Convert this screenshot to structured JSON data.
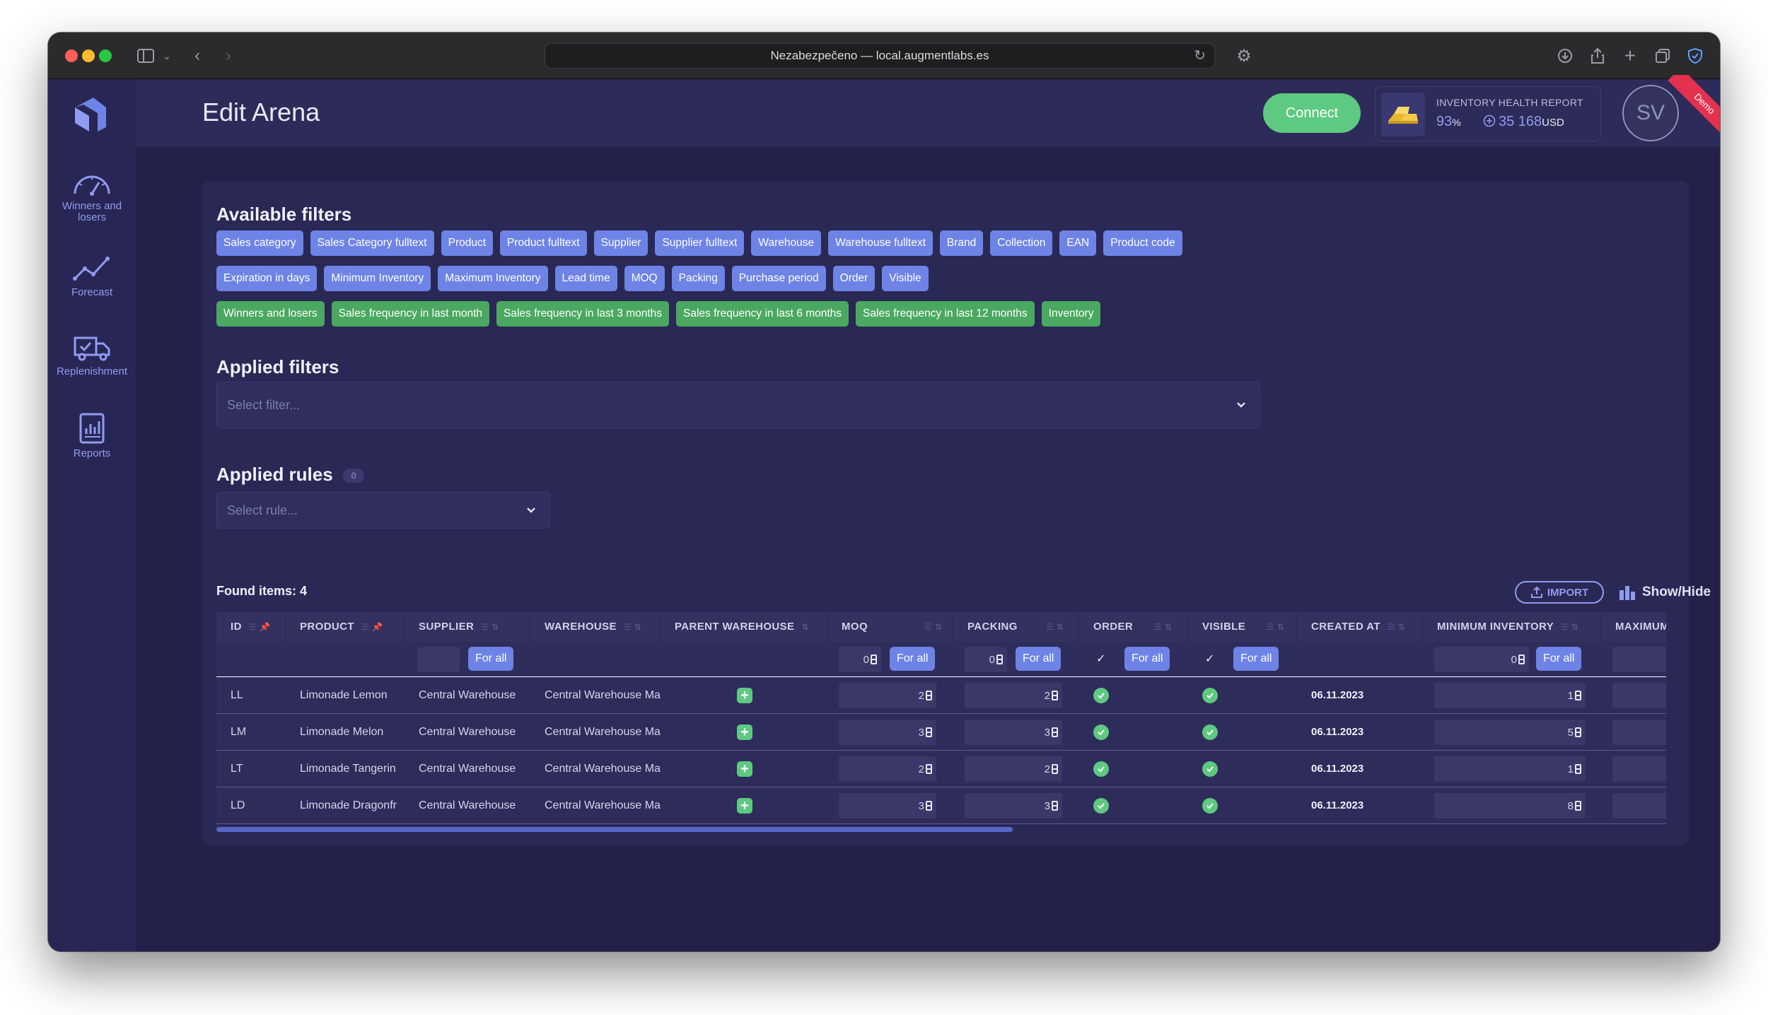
{
  "browser": {
    "url": "Nezabezpečeno — local.augmentlabs.es"
  },
  "sidebar": {
    "items": [
      {
        "label": "Winners and losers",
        "icon": "speedometer-icon"
      },
      {
        "label": "Forecast",
        "icon": "line-chart-icon"
      },
      {
        "label": "Replenishment",
        "icon": "truck-icon"
      },
      {
        "label": "Reports",
        "icon": "report-icon"
      }
    ]
  },
  "header": {
    "title": "Edit Arena",
    "connect_label": "Connect",
    "health": {
      "title": "INVENTORY HEALTH REPORT",
      "percent": "93",
      "percent_unit": "%",
      "value": "35 168",
      "currency": "USD"
    },
    "avatar_initials": "SV",
    "ribbon": "Demo"
  },
  "available_filters": {
    "title": "Available filters",
    "row1": [
      "Sales category",
      "Sales Category fulltext",
      "Product",
      "Product fulltext",
      "Supplier",
      "Supplier fulltext",
      "Warehouse",
      "Warehouse fulltext",
      "Brand",
      "Collection",
      "EAN",
      "Product code"
    ],
    "row2": [
      "Expiration in days",
      "Minimum Inventory",
      "Maximum Inventory",
      "Lead time",
      "MOQ",
      "Packing",
      "Purchase period",
      "Order",
      "Visible"
    ],
    "row3": [
      "Winners and losers",
      "Sales frequency in last month",
      "Sales frequency in last 3 months",
      "Sales frequency in last 6 months",
      "Sales frequency in last 12 months",
      "Inventory"
    ]
  },
  "applied_filters": {
    "title": "Applied filters",
    "placeholder": "Select filter..."
  },
  "applied_rules": {
    "title": "Applied rules",
    "count": "0",
    "placeholder": "Select rule..."
  },
  "table": {
    "found_label": "Found items: 4",
    "import_label": "IMPORT",
    "showhide_label": "Show/Hide",
    "columns": [
      "ID",
      "PRODUCT",
      "SUPPLIER",
      "WAREHOUSE",
      "PARENT WAREHOUSE",
      "MOQ",
      "PACKING",
      "ORDER",
      "VISIBLE",
      "CREATED AT",
      "MINIMUM INVENTORY",
      "MAXIMUM I"
    ],
    "filter_row": {
      "for_all": "For all",
      "moq": "0",
      "packing": "0",
      "min_inventory": "0"
    },
    "rows": [
      {
        "id": "LL",
        "product": "Limonade Lemon",
        "supplier": "Central Warehouse",
        "warehouse": "Central Warehouse Ma",
        "moq": "2",
        "packing": "2",
        "created": "06.11.2023",
        "min_inv": "1"
      },
      {
        "id": "LM",
        "product": "Limonade Melon",
        "supplier": "Central Warehouse",
        "warehouse": "Central Warehouse Ma",
        "moq": "3",
        "packing": "3",
        "created": "06.11.2023",
        "min_inv": "5"
      },
      {
        "id": "LT",
        "product": "Limonade Tangerin",
        "supplier": "Central Warehouse",
        "warehouse": "Central Warehouse Ma",
        "moq": "2",
        "packing": "2",
        "created": "06.11.2023",
        "min_inv": "1"
      },
      {
        "id": "LD",
        "product": "Limonade Dragonfr",
        "supplier": "Central Warehouse",
        "warehouse": "Central Warehouse Ma",
        "moq": "3",
        "packing": "3",
        "created": "06.11.2023",
        "min_inv": "8"
      }
    ]
  }
}
